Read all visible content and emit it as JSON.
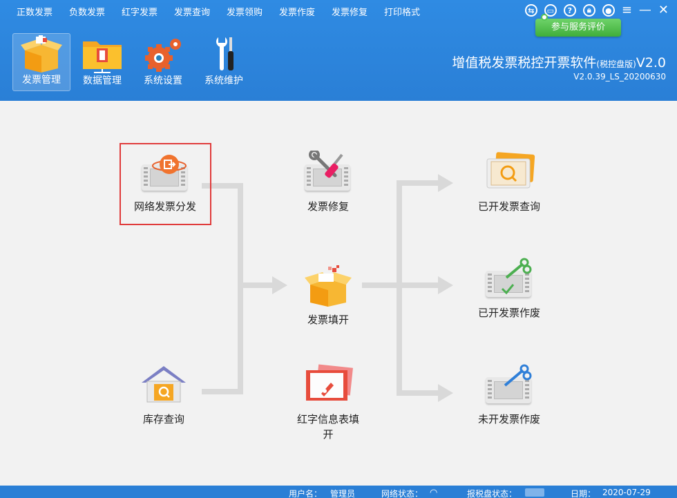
{
  "menu": {
    "items": [
      "正数发票",
      "负数发票",
      "红字发票",
      "发票查询",
      "发票领购",
      "发票作废",
      "发票修复",
      "打印格式"
    ]
  },
  "top_icons": [
    "sync-icon",
    "chat-icon",
    "help-icon",
    "lock-icon",
    "user-icon",
    "menu-icon",
    "minimize-icon",
    "close-icon"
  ],
  "feedback_button": "参与服务评价",
  "toolbar": {
    "items": [
      {
        "label": "发票管理",
        "icon": "invoice-box-icon",
        "active": true
      },
      {
        "label": "数据管理",
        "icon": "folder-icon",
        "active": false
      },
      {
        "label": "系统设置",
        "icon": "gear-icon",
        "active": false
      },
      {
        "label": "系统维护",
        "icon": "tools-icon",
        "active": false
      }
    ]
  },
  "app": {
    "title": "增值税发票税控开票软件",
    "edition": "(税控盘版)",
    "version_suffix": "V2.0",
    "build": "V2.0.39_LS_20200630"
  },
  "nodes": {
    "network_dispatch": "网络发票分发",
    "invoice_repair": "发票修复",
    "issued_query": "已开发票查询",
    "invoice_fill": "发票填开",
    "issued_void": "已开发票作废",
    "inventory_query": "库存查询",
    "red_info_fill": "红字信息表填开",
    "unissued_void": "未开发票作废"
  },
  "status": {
    "user_label": "用户名：",
    "user_value": "管理员",
    "network_label": "网络状态：",
    "disk_label": "报税盘状态：",
    "date_label": "日期：",
    "date_value": "2020-07-29"
  },
  "colors": {
    "header_blue": "#2e86de",
    "accent_green": "#4cbb47",
    "highlight_red": "#e03b3b"
  }
}
